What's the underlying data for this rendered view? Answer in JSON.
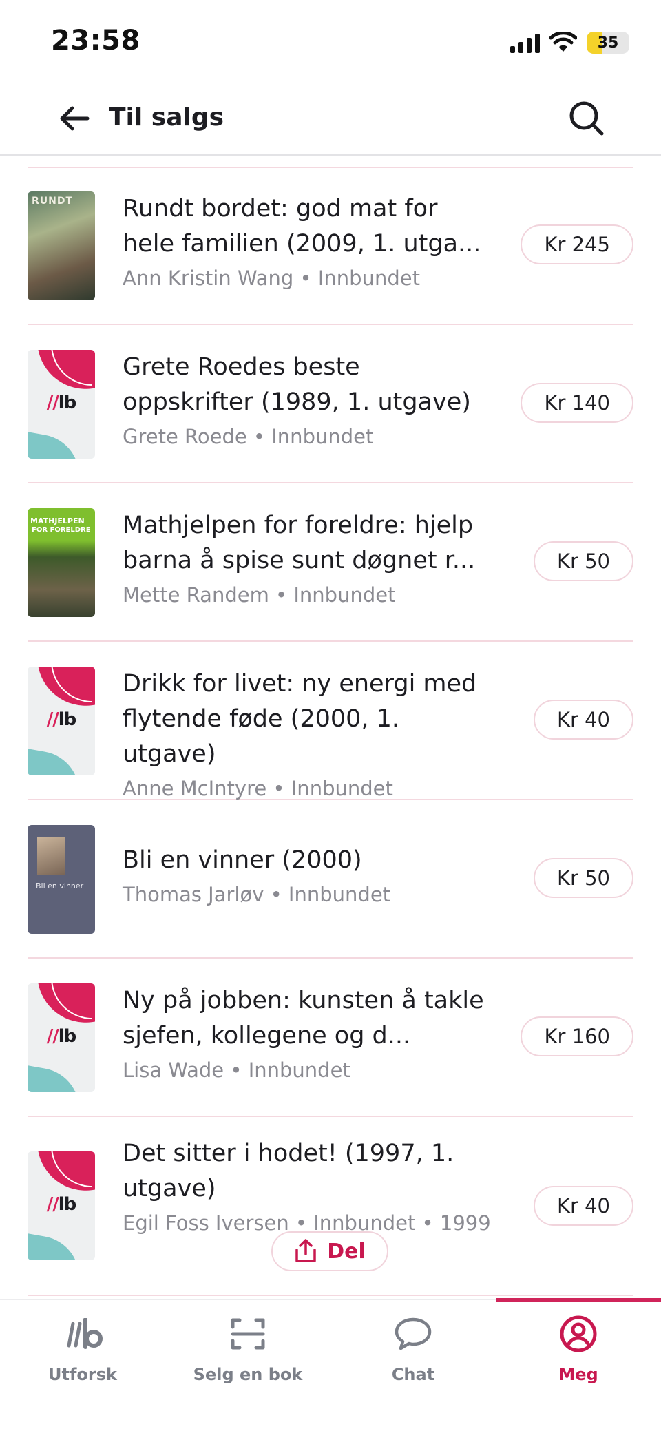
{
  "status_bar": {
    "time": "23:58",
    "battery": "35",
    "battery_level": 0.35
  },
  "header": {
    "title": "Til salgs"
  },
  "items": [
    {
      "title": "Rundt bordet: god mat for hele familien (2009, 1. utga...",
      "meta": "Ann Kristin Wang • Innbundet",
      "price": "Kr 245",
      "cover": "photo",
      "cover_text": "RUNDT"
    },
    {
      "title": "Grete Roedes beste oppskrifter (1989, 1. utgave)",
      "meta": "Grete Roede • Innbundet",
      "price": "Kr 140",
      "cover": "placeholder"
    },
    {
      "title": "Mathjelpen for foreldre: hjelp barna å spise sunt døgnet r...",
      "meta": "Mette Randem • Innbundet",
      "price": "Kr 50",
      "cover": "photo",
      "cover_text_1": "MATHJELPEN",
      "cover_text_2": "FOR FORELDRE"
    },
    {
      "title": "Drikk for livet: ny energi med flytende føde (2000, 1. utgave)",
      "meta": "Anne McIntyre • Innbundet",
      "price": "Kr 40",
      "cover": "placeholder"
    },
    {
      "title": "Bli en vinner (2000)",
      "meta": "Thomas Jarløv • Innbundet",
      "price": "Kr 50",
      "cover": "photo",
      "cover_text": "Bli en vinner"
    },
    {
      "title": "Ny på jobben: kunsten å takle sjefen, kollegene og d...",
      "meta": "Lisa Wade • Innbundet",
      "price": "Kr 160",
      "cover": "placeholder"
    },
    {
      "title": "Det sitter i hodet! (1997, 1. utgave)",
      "meta": "Egil Foss Iversen • Innbundet • 1999",
      "price": "Kr 40",
      "cover": "placeholder"
    }
  ],
  "placeholder_logo": "lb",
  "share": {
    "label": "Del"
  },
  "tabs": [
    {
      "label": "Utforsk",
      "icon": "lb-logo-icon"
    },
    {
      "label": "Selg en bok",
      "icon": "scan-icon"
    },
    {
      "label": "Chat",
      "icon": "chat-bubble-icon"
    },
    {
      "label": "Meg",
      "icon": "user-circle-icon",
      "active": true
    }
  ],
  "colors": {
    "accent": "#c8184f",
    "divider": "#f4d8df",
    "muted_text": "#8a8a91"
  }
}
